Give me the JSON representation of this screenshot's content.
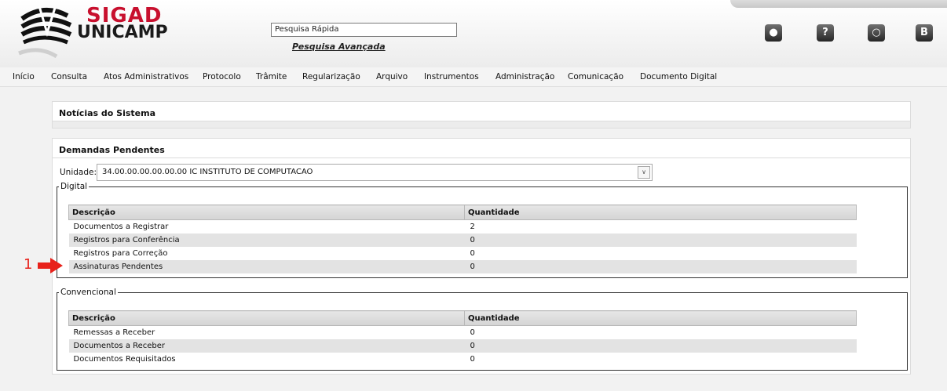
{
  "header": {
    "logo_line1": "SIGAD",
    "logo_line2": "UNICAMP",
    "search_value": "Pesquisa Rápida",
    "search_advanced": "Pesquisa Avançada",
    "tool_icons": [
      "user-icon",
      "help-icon",
      "chat-icon",
      "b-icon"
    ]
  },
  "menu": [
    "Início",
    "Consulta",
    "Atos Administrativos",
    "Protocolo",
    "Trâmite",
    "Regularização",
    "Arquivo",
    "Instrumentos",
    "Administração",
    "Comunicação",
    "Documento Digital"
  ],
  "news": {
    "title": "Notícias do Sistema"
  },
  "demands": {
    "title": "Demandas Pendentes",
    "unit_label": "Unidade:",
    "unit_value": "34.00.00.00.00.00.00 IC INSTITUTO DE COMPUTACAO",
    "digital": {
      "legend": "Digital",
      "headers": [
        "Descrição",
        "Quantidade"
      ],
      "rows": [
        [
          "Documentos a Registrar",
          "2"
        ],
        [
          "Registros para Conferência",
          "0"
        ],
        [
          "Registros para Correção",
          "0"
        ],
        [
          "Assinaturas Pendentes",
          "0"
        ]
      ]
    },
    "conventional": {
      "legend": "Convencional",
      "headers": [
        "Descrição",
        "Quantidade"
      ],
      "rows": [
        [
          "Remessas a Receber",
          "0"
        ],
        [
          "Documentos a Receber",
          "0"
        ],
        [
          "Documentos Requisitados",
          "0"
        ]
      ]
    }
  },
  "annotation": {
    "label": "1",
    "color": "#e8221b"
  }
}
